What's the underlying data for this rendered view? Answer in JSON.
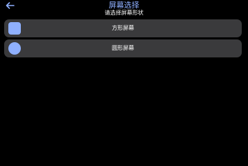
{
  "header": {
    "title": "屏幕选择",
    "subtitle": "请选择屏幕形状",
    "back_icon": "arrow-left-icon"
  },
  "options": [
    {
      "label": "方形屏幕",
      "icon": "square-shape-icon"
    },
    {
      "label": "圆形屏幕",
      "icon": "circle-shape-icon"
    }
  ],
  "colors": {
    "background": "#000000",
    "card": "#3a3a3c",
    "accent": "#8fb0ff",
    "text": "#ffffff"
  }
}
